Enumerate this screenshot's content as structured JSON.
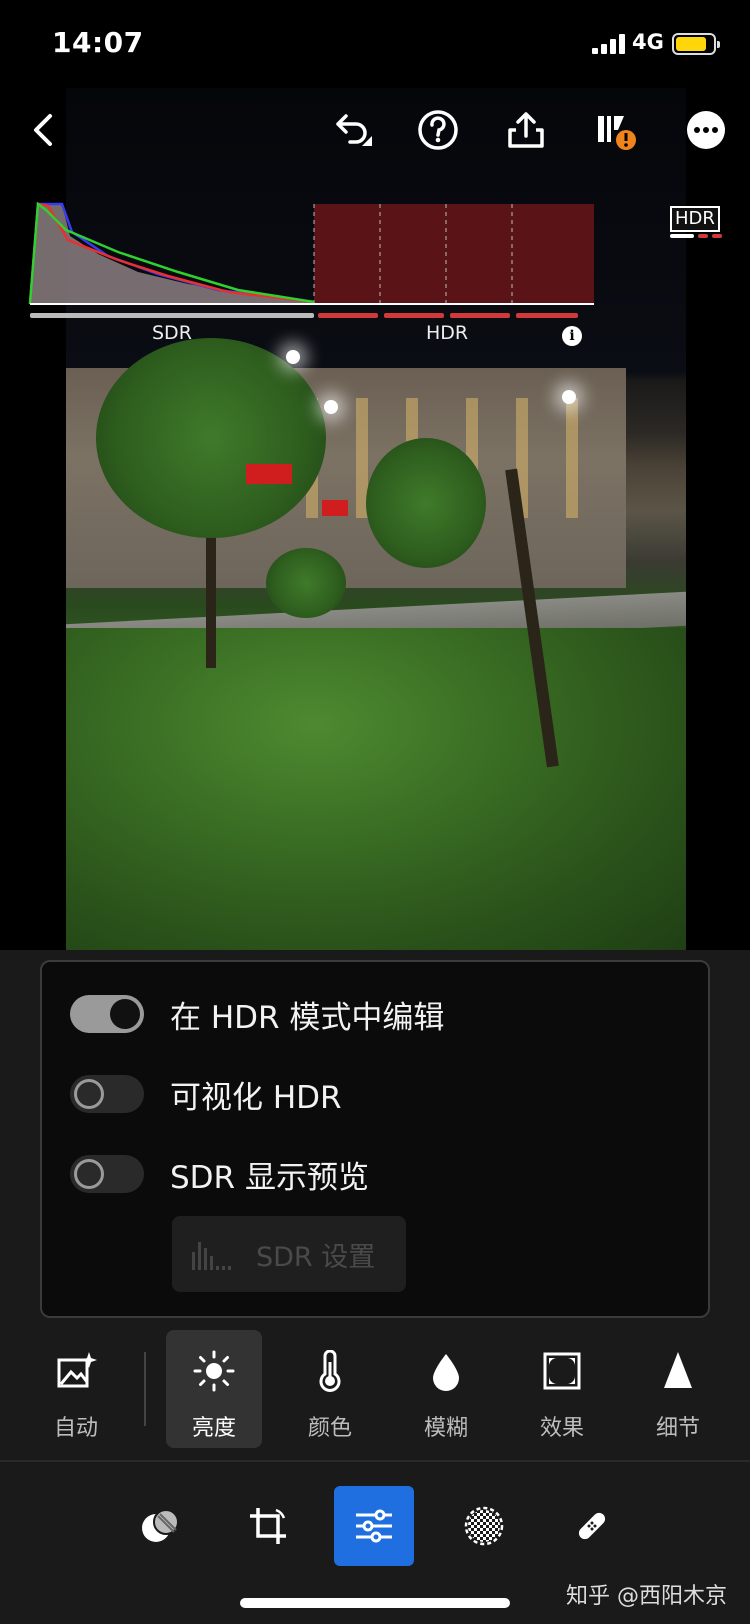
{
  "status_bar": {
    "time": "14:07",
    "network": "4G",
    "battery_color": "#ffd60a"
  },
  "toolbar": {
    "icons": [
      "back-icon",
      "undo-icon",
      "help-icon",
      "share-icon",
      "cloud-sync-warning-icon",
      "more-icon"
    ]
  },
  "histogram": {
    "sdr_label": "SDR",
    "hdr_label": "HDR",
    "info_icon": "i",
    "hdr_zone_color": "#5a1418"
  },
  "hdr_badge": "HDR",
  "panel": {
    "toggles": [
      {
        "label": "在 HDR 模式中编辑",
        "on": true
      },
      {
        "label": "可视化 HDR",
        "on": false
      },
      {
        "label": "SDR 显示预览",
        "on": false
      }
    ],
    "sdr_settings_label": "SDR 设置",
    "sdr_settings_enabled": false
  },
  "tools": [
    {
      "label": "自动",
      "icon": "auto-enhance-icon",
      "active": false
    },
    {
      "label": "亮度",
      "icon": "sun-icon",
      "active": true
    },
    {
      "label": "颜色",
      "icon": "thermometer-icon",
      "active": false
    },
    {
      "label": "模糊",
      "icon": "drop-icon",
      "active": false
    },
    {
      "label": "效果",
      "icon": "vignette-icon",
      "active": false
    },
    {
      "label": "细节",
      "icon": "triangle-icon",
      "active": false
    }
  ],
  "modes": [
    {
      "icon": "presets-icon",
      "active": false
    },
    {
      "icon": "crop-icon",
      "active": false
    },
    {
      "icon": "sliders-icon",
      "active": true
    },
    {
      "icon": "masking-icon",
      "active": false
    },
    {
      "icon": "healing-bandage-icon",
      "active": false
    }
  ],
  "watermark": "知乎 @西阳木京",
  "accent_color": "#1f6fe0"
}
